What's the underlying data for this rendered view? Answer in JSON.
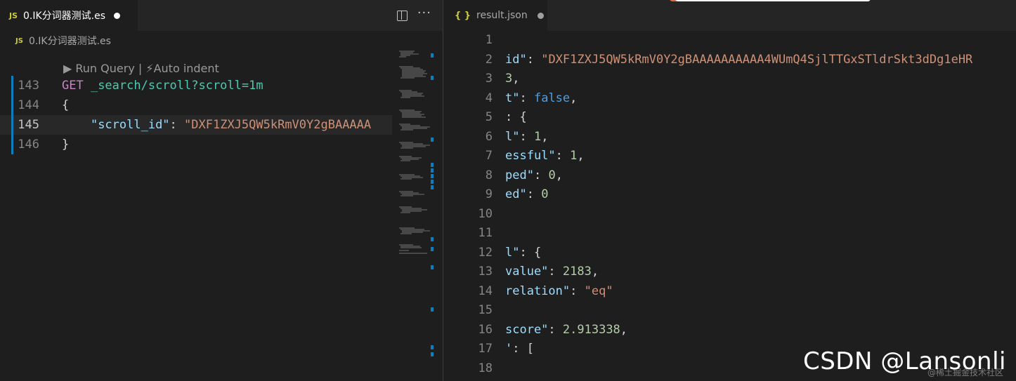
{
  "left": {
    "tab": {
      "icon": "JS",
      "label": "0.IK分词器测试.es"
    },
    "breadcrumb": {
      "icon": "JS",
      "label": "0.IK分词器测试.es"
    },
    "codelens": {
      "run_query": "▶ Run Query",
      "separator": " | ",
      "auto_indent": "⚡Auto indent"
    },
    "lines": [
      {
        "num": "143",
        "method": "GET",
        "path": " _search/scroll?scroll=1m"
      },
      {
        "num": "144",
        "text": "{"
      },
      {
        "num": "145",
        "key": "\"scroll_id\"",
        "colon": ": ",
        "value": "\"DXF1ZXJ5QW5kRmV0Y2gBAAAAA"
      },
      {
        "num": "146",
        "text": "}"
      }
    ]
  },
  "right": {
    "tab": {
      "icon": "{ }",
      "label": "result.json"
    },
    "lines": [
      {
        "num": "1",
        "parts": []
      },
      {
        "num": "2",
        "parts": [
          [
            "key",
            "id\""
          ],
          [
            "plain",
            ": "
          ],
          [
            "str",
            "\"DXF1ZXJ5QW5kRmV0Y2gBAAAAAAAAAA4WUmQ4SjlTTGxSTldrSkt3dDg1eHR"
          ]
        ]
      },
      {
        "num": "3",
        "parts": [
          [
            "num",
            "3"
          ],
          [
            "plain",
            ","
          ]
        ]
      },
      {
        "num": "4",
        "parts": [
          [
            "key",
            "t\""
          ],
          [
            "plain",
            ": "
          ],
          [
            "bool",
            "false"
          ],
          [
            "plain",
            ","
          ]
        ]
      },
      {
        "num": "5",
        "parts": [
          [
            "plain",
            ": {"
          ]
        ]
      },
      {
        "num": "6",
        "parts": [
          [
            "key",
            "l\""
          ],
          [
            "plain",
            ": "
          ],
          [
            "num",
            "1"
          ],
          [
            "plain",
            ","
          ]
        ]
      },
      {
        "num": "7",
        "parts": [
          [
            "key",
            "essful\""
          ],
          [
            "plain",
            ": "
          ],
          [
            "num",
            "1"
          ],
          [
            "plain",
            ","
          ]
        ]
      },
      {
        "num": "8",
        "parts": [
          [
            "key",
            "ped\""
          ],
          [
            "plain",
            ": "
          ],
          [
            "num",
            "0"
          ],
          [
            "plain",
            ","
          ]
        ]
      },
      {
        "num": "9",
        "parts": [
          [
            "key",
            "ed\""
          ],
          [
            "plain",
            ": "
          ],
          [
            "num",
            "0"
          ]
        ]
      },
      {
        "num": "10",
        "parts": []
      },
      {
        "num": "11",
        "parts": []
      },
      {
        "num": "12",
        "parts": [
          [
            "key",
            "l\""
          ],
          [
            "plain",
            ": {"
          ]
        ]
      },
      {
        "num": "13",
        "parts": [
          [
            "key",
            "value\""
          ],
          [
            "plain",
            ": "
          ],
          [
            "num",
            "2183"
          ],
          [
            "plain",
            ","
          ]
        ]
      },
      {
        "num": "14",
        "parts": [
          [
            "key",
            "relation\""
          ],
          [
            "plain",
            ": "
          ],
          [
            "str",
            "\"eq\""
          ]
        ]
      },
      {
        "num": "15",
        "parts": []
      },
      {
        "num": "16",
        "parts": [
          [
            "key",
            "score\""
          ],
          [
            "plain",
            ": "
          ],
          [
            "num",
            "2.913338"
          ],
          [
            "plain",
            ","
          ]
        ]
      },
      {
        "num": "17",
        "parts": [
          [
            "key",
            "'"
          ],
          [
            "plain",
            ": ["
          ]
        ]
      },
      {
        "num": "18",
        "parts": []
      }
    ]
  },
  "watermark": "CSDN @Lansonli",
  "watermark_sub": "@稀土掘金技术社区",
  "colors": {
    "background": "#1e1e1e",
    "gutter_mark": "#0c7dbd",
    "keyword": "#c586c0",
    "path": "#4ec9b0",
    "key": "#9cdcfe",
    "string": "#ce9178",
    "number": "#b5cea8",
    "boolean": "#569cd6"
  }
}
